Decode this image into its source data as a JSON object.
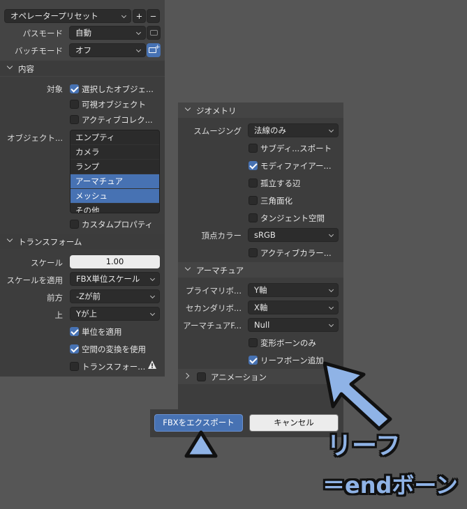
{
  "left": {
    "preset": {
      "label": "オペレータープリセット",
      "add": "+",
      "remove": "−"
    },
    "path_mode": {
      "label": "パスモード",
      "value": "自動"
    },
    "batch_mode": {
      "label": "バッチモード",
      "value": "オフ"
    },
    "include": {
      "title": "内容",
      "target_label": "対象",
      "targets": [
        {
          "label": "選択したオブジェ...",
          "checked": true
        },
        {
          "label": "可視オブジェクト",
          "checked": false
        },
        {
          "label": "アクティブコレク...",
          "checked": false
        }
      ],
      "object_types_label": "オブジェクト...",
      "object_types": [
        {
          "label": "エンプティ",
          "selected": false
        },
        {
          "label": "カメラ",
          "selected": false
        },
        {
          "label": "ランプ",
          "selected": false
        },
        {
          "label": "アーマチュア",
          "selected": true
        },
        {
          "label": "メッシュ",
          "selected": true
        },
        {
          "label": "その他",
          "selected": false
        }
      ],
      "custom_props": {
        "label": "カスタムプロパティ",
        "checked": false
      }
    },
    "transform": {
      "title": "トランスフォーム",
      "scale_label": "スケール",
      "scale_value": "1.00",
      "apply_scaling_label": "スケールを適用",
      "apply_scaling_value": "FBX単位スケール",
      "forward_label": "前方",
      "forward_value": "-Zが前",
      "up_label": "上",
      "up_value": "Yが上",
      "apply_unit": {
        "label": "単位を適用",
        "checked": true
      },
      "use_space_transform": {
        "label": "空間の変換を使用",
        "checked": true
      },
      "apply_transform": {
        "label": "トランスフォー...",
        "checked": false
      }
    }
  },
  "right": {
    "geometry": {
      "title": "ジオメトリ",
      "smoothing_label": "スムージング",
      "smoothing_value": "法線のみ",
      "checks": [
        {
          "label": "サブディ...スポート",
          "checked": false
        },
        {
          "label": "モディファイアー...",
          "checked": true
        },
        {
          "label": "孤立する辺",
          "checked": false
        },
        {
          "label": "三角面化",
          "checked": false
        },
        {
          "label": "タンジェント空間",
          "checked": false
        }
      ],
      "vertex_color_label": "頂点カラー",
      "vertex_color_value": "sRGB",
      "active_color": {
        "label": "アクティブカラー...",
        "checked": false
      }
    },
    "armature": {
      "title": "アーマチュア",
      "primary_label": "プライマリボ...",
      "primary_value": "Y軸",
      "secondary_label": "セカンダリボ...",
      "secondary_value": "X軸",
      "node_type_label": "アーマチュアF...",
      "node_type_value": "Null",
      "deform_only": {
        "label": "変形ボーンのみ",
        "checked": false
      },
      "add_leaf": {
        "label": "リーフボーン追加",
        "checked": true
      }
    },
    "animation": {
      "title": "アニメーション",
      "checked": false
    }
  },
  "footer": {
    "export": "FBXをエクスポート",
    "cancel": "キャンセル"
  },
  "annotation": {
    "line1": "リーフ",
    "line2": "＝endボーン",
    "color": "#8fb3e6"
  }
}
